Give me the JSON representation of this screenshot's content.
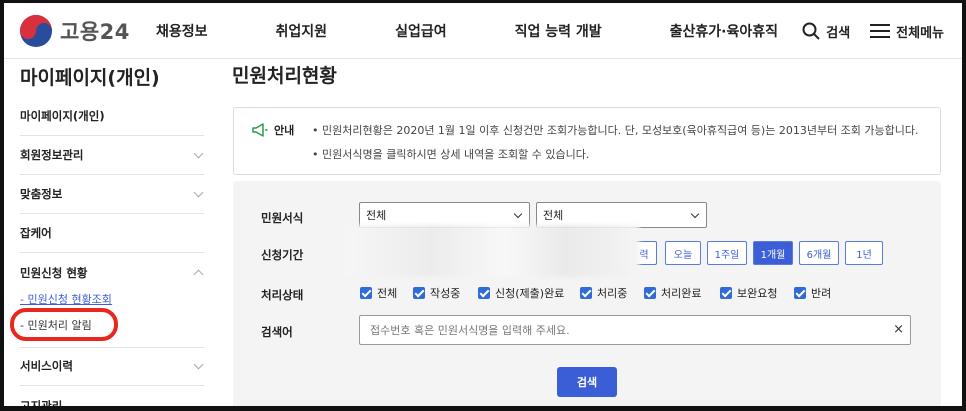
{
  "header": {
    "logo_text": "고용24",
    "nav": [
      "채용정보",
      "취업지원",
      "실업급여",
      "직업 능력 개발",
      "출산휴가·육아휴직"
    ],
    "search_label": "검색",
    "menu_label": "전체메뉴"
  },
  "sidebar": {
    "title": "마이페이지(개인)",
    "items": [
      "마이페이지(개인)",
      "회원정보관리",
      "맞춤정보",
      "잡케어",
      "민원신청 현황",
      "서비스이력",
      "고지관리"
    ],
    "sub_items": [
      "민원신청 현황조회",
      "민원처리 알림"
    ]
  },
  "main": {
    "title": "민원처리현황",
    "notice": {
      "label": "안내",
      "lines": [
        "• 민원처리현황은 2020년 1월 1일 이후 신청건만 조회가능합니다. 단, 모성보호(육아휴직급여 등)는 2013년부터 조회 가능합니다.",
        "• 민원서식명을 클릭하시면 상세 내역을 조회할 수 있습니다."
      ]
    },
    "form": {
      "type_label": "민원서식",
      "type_select_1": "전체",
      "type_select_2": "전체",
      "period_label": "신청기간",
      "period_buttons": [
        "력",
        "오늘",
        "1주일",
        "1개월",
        "6개월",
        "1년"
      ],
      "period_active": "1개월",
      "status_label": "처리상태",
      "statuses": [
        "전체",
        "작성중",
        "신청(제출)완료",
        "처리중",
        "처리완료",
        "보완요청",
        "반려"
      ],
      "keyword_label": "검색어",
      "keyword_placeholder": "접수번호 혹은 민원서식명을 입력해 주세요.",
      "clear": "×",
      "search_button": "검색"
    }
  },
  "colors": {
    "accent": "#3b5ed6",
    "highlight": "#e8281e"
  }
}
